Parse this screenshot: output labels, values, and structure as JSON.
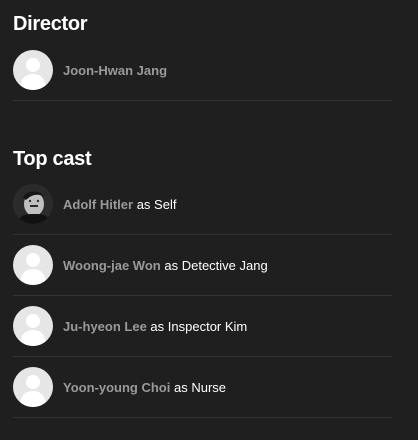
{
  "director": {
    "title": "Director",
    "people": [
      {
        "name": "Joon-Hwan Jang",
        "avatar": "placeholder-avatar"
      }
    ]
  },
  "cast": {
    "title": "Top cast",
    "people": [
      {
        "name": "Adolf Hitler",
        "as": "as",
        "role": "Self",
        "avatar": "photo-avatar"
      },
      {
        "name": "Woong-jae Won",
        "as": "as",
        "role": "Detective Jang",
        "avatar": "placeholder-avatar"
      },
      {
        "name": "Ju-hyeon Lee",
        "as": "as",
        "role": "Inspector Kim",
        "avatar": "placeholder-avatar"
      },
      {
        "name": "Yoon-young Choi",
        "as": "as",
        "role": "Nurse",
        "avatar": "placeholder-avatar"
      }
    ]
  },
  "colors": {
    "background": "#1f1f1f",
    "name_link": "#9a9a9a",
    "text": "#ffffff",
    "divider": "#333333",
    "avatar_bg": "#e6e6e6",
    "avatar_silhouette": "#ffffff"
  }
}
